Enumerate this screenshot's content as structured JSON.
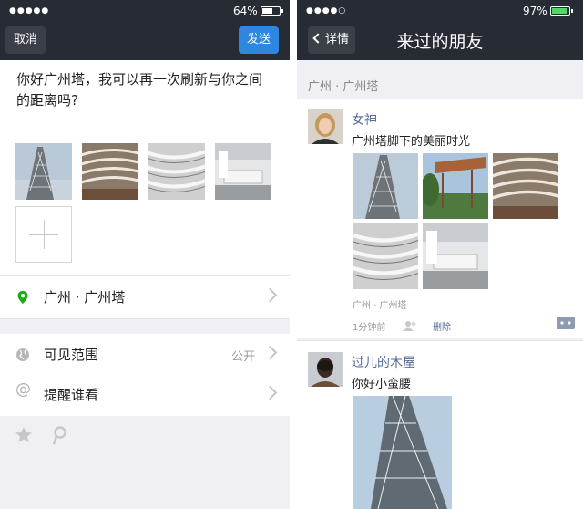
{
  "left": {
    "status": {
      "signal": "●●●●●",
      "battery_text": "64%",
      "battery_level": 0.64
    },
    "nav": {
      "cancel_label": "取消",
      "send_label": "发送"
    },
    "compose_text": "你好广州塔，我可以再一次刷新与你之间的距离吗?",
    "location": {
      "label": "广州 · 广州塔"
    },
    "visibility": {
      "label": "可见范围",
      "value": "公开"
    },
    "mention": {
      "label": "提醒谁看"
    }
  },
  "right": {
    "status": {
      "signal": "●●●●○",
      "battery_text": "97%",
      "battery_level": 0.97
    },
    "nav": {
      "back_label": "详情",
      "title": "来过的朋友"
    },
    "location_header": "广州 · 广州塔",
    "posts": [
      {
        "name": "女神",
        "text": "广州塔脚下的美丽时光",
        "location": "广州 · 广州塔",
        "time": "1分钟前",
        "delete_label": "删除"
      },
      {
        "name": "过儿的木屋",
        "text": "你好小蛮腰"
      }
    ]
  },
  "colors": {
    "nav_bg": "#262b34",
    "send_button": "#2e86de",
    "link": "#576b95",
    "page_bg": "#efeff4"
  }
}
